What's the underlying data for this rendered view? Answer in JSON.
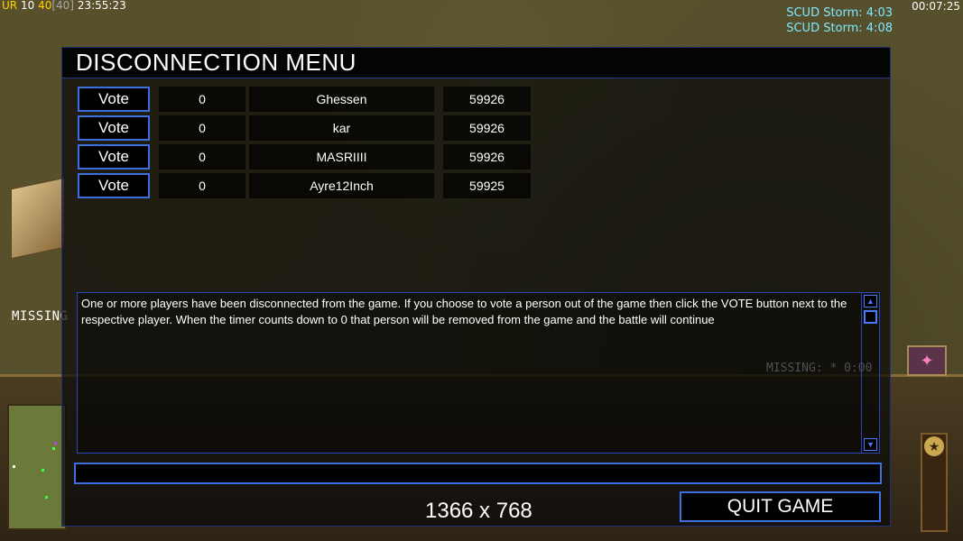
{
  "hud": {
    "ur_label": "UR",
    "count1": "10",
    "count2": "40",
    "limit": "[40]",
    "clock": "23:55:23",
    "timer_right": "00:07:25",
    "scud_storms": [
      "SCUD Storm: 4:03",
      "SCUD Storm: 4:08"
    ],
    "missing_left": "MISSING",
    "missing_bg": "MISSING: * 0:00"
  },
  "dialog": {
    "title": "DISCONNECTION MENU",
    "players": [
      {
        "vote_label": "Vote",
        "votes": "0",
        "name": "Ghessen",
        "ping": "59926"
      },
      {
        "vote_label": "Vote",
        "votes": "0",
        "name": "kar",
        "ping": "59926"
      },
      {
        "vote_label": "Vote",
        "votes": "0",
        "name": "MASRIIII",
        "ping": "59926"
      },
      {
        "vote_label": "Vote",
        "votes": "0",
        "name": "Ayre12Inch",
        "ping": "59925"
      }
    ],
    "message": "One or more players have been disconnected from the game. If you choose to vote a person out of the game then click the VOTE button next to the respective player. When the timer counts down to 0 that person will be removed from the game and the battle will continue",
    "chat_value": "",
    "quit_label": "QUIT GAME",
    "resolution": "1366 x 768"
  },
  "colors": {
    "accent_border": "#3c6fe0",
    "scud_text": "#7fe8ff",
    "ur_yellow": "#ffd200"
  }
}
